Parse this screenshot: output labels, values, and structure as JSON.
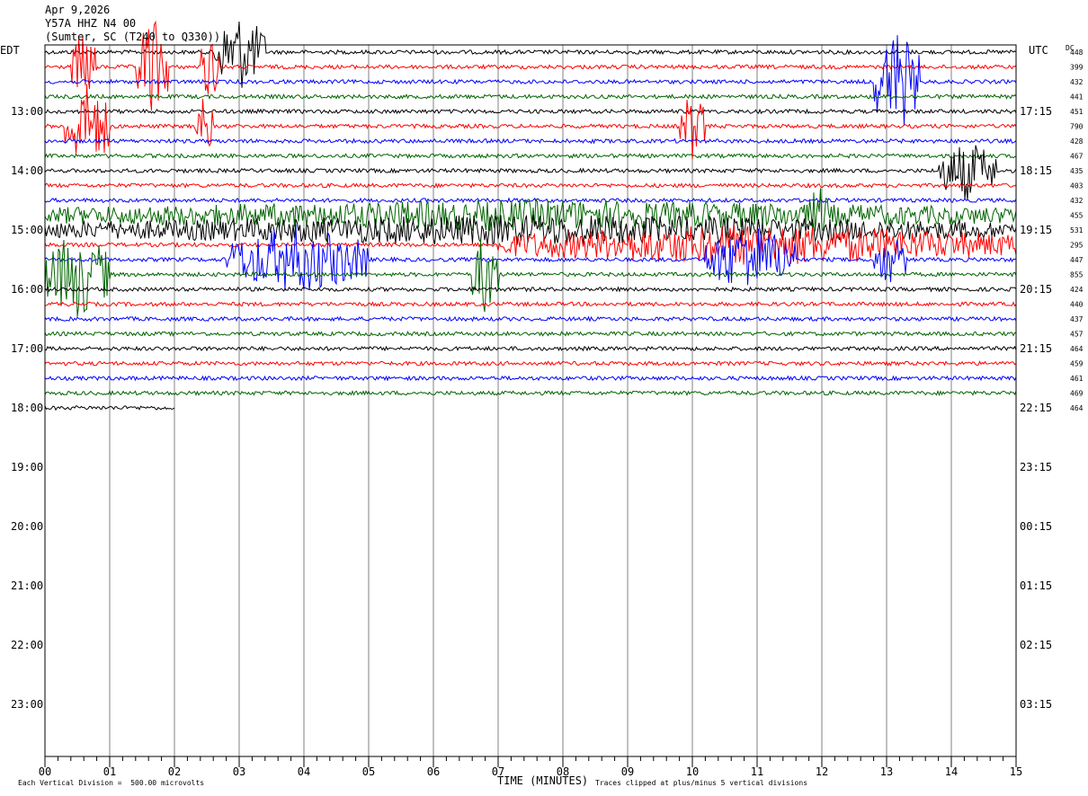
{
  "header": {
    "date": "Apr 9,2026",
    "station": "Y57A HHZ N4 00",
    "location": "(Sumter, SC (T240 to Q330))"
  },
  "labels": {
    "left_tz": "EDT",
    "right_tz": "UTC",
    "dc_header": "DC",
    "xlabel": "TIME (MINUTES)",
    "scale_note": "Each Vertical Division =  500.00 microvolts",
    "clip_note": "Traces clipped at plus/minus 5 vertical divisions"
  },
  "chart_data": {
    "type": "line",
    "title": "Y57A HHZ N4 00",
    "xlabel": "TIME (MINUTES)",
    "xlim": [
      0,
      15
    ],
    "x_ticks": [
      "00",
      "01",
      "02",
      "03",
      "04",
      "05",
      "06",
      "07",
      "08",
      "09",
      "10",
      "11",
      "12",
      "13",
      "14",
      "15"
    ],
    "rows_per_hour": 4,
    "row_minutes": 15,
    "left_hour_labels": [
      "13:00",
      "14:00",
      "15:00",
      "16:00",
      "17:00",
      "18:00",
      "19:00",
      "20:00",
      "21:00",
      "22:00",
      "23:00"
    ],
    "right_hour_labels": [
      "17:15",
      "18:15",
      "19:15",
      "20:15",
      "21:15",
      "22:15",
      "23:15",
      "00:15",
      "01:15",
      "02:15",
      "03:15"
    ],
    "trace_colors": [
      "#000000",
      "#ff0000",
      "#0000ff",
      "#006400"
    ],
    "dc_offsets": [
      448,
      399,
      432,
      441,
      451,
      790,
      428,
      467,
      435,
      403,
      432,
      455,
      531,
      295,
      447,
      855,
      424,
      440,
      437,
      457,
      464,
      459,
      461,
      469,
      464
    ],
    "traces_recorded": 25,
    "last_trace_end_minute": 2.0,
    "events": [
      {
        "row": 0,
        "start_min": 2.6,
        "end_min": 3.4,
        "amp": 4.5
      },
      {
        "row": 1,
        "start_min": 1.4,
        "end_min": 1.9,
        "amp": 6
      },
      {
        "row": 1,
        "start_min": 2.4,
        "end_min": 2.7,
        "amp": 4
      },
      {
        "row": 1,
        "start_min": 0.4,
        "end_min": 0.8,
        "amp": 4
      },
      {
        "row": 2,
        "start_min": 12.8,
        "end_min": 13.5,
        "amp": 6
      },
      {
        "row": 5,
        "start_min": 0.3,
        "end_min": 1.0,
        "amp": 5
      },
      {
        "row": 5,
        "start_min": 9.8,
        "end_min": 10.2,
        "amp": 4
      },
      {
        "row": 5,
        "start_min": 2.3,
        "end_min": 2.6,
        "amp": 3.5
      },
      {
        "row": 8,
        "start_min": 13.8,
        "end_min": 14.7,
        "amp": 3.5
      },
      {
        "row": 11,
        "start_min": 0.0,
        "end_min": 15.0,
        "amp": 1.8
      },
      {
        "row": 12,
        "start_min": 0.0,
        "end_min": 15.0,
        "amp": 1.8
      },
      {
        "row": 13,
        "start_min": 7.0,
        "end_min": 15.0,
        "amp": 2.4
      },
      {
        "row": 14,
        "start_min": 2.8,
        "end_min": 5.0,
        "amp": 4
      },
      {
        "row": 14,
        "start_min": 10.2,
        "end_min": 11.6,
        "amp": 4
      },
      {
        "row": 15,
        "start_min": 0.0,
        "end_min": 1.0,
        "amp": 5
      },
      {
        "row": 15,
        "start_min": 6.6,
        "end_min": 7.0,
        "amp": 5
      },
      {
        "row": 11,
        "start_min": 11.8,
        "end_min": 12.1,
        "amp": 3.5
      },
      {
        "row": 14,
        "start_min": 12.8,
        "end_min": 13.3,
        "amp": 3
      }
    ]
  }
}
